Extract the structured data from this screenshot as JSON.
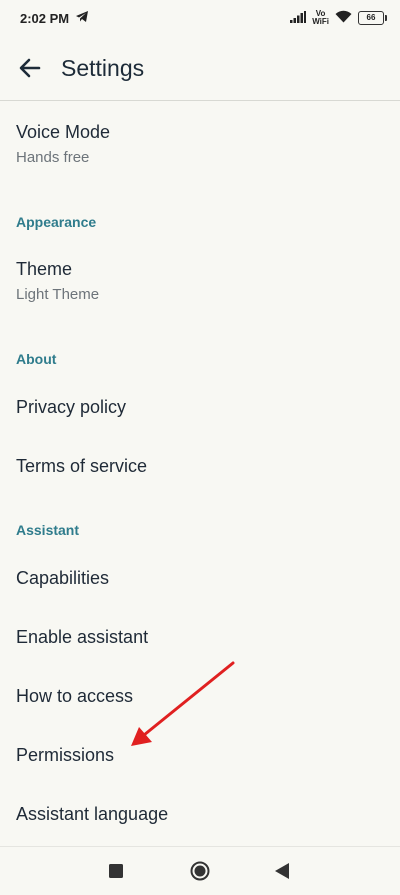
{
  "status_bar": {
    "time": "2:02 PM",
    "vowifi_top": "Vo",
    "vowifi_bottom": "WiFi",
    "battery": "66"
  },
  "header": {
    "title": "Settings"
  },
  "settings": {
    "voice_mode": {
      "title": "Voice Mode",
      "value": "Hands free"
    },
    "appearance_header": "Appearance",
    "theme": {
      "title": "Theme",
      "value": "Light Theme"
    },
    "about_header": "About",
    "privacy_policy": "Privacy policy",
    "terms_of_service": "Terms of service",
    "assistant_header": "Assistant",
    "capabilities": "Capabilities",
    "enable_assistant": "Enable assistant",
    "how_to_access": "How to access",
    "permissions": "Permissions",
    "assistant_language": "Assistant language"
  },
  "colors": {
    "background": "#f8f8f3",
    "section_header": "#2f7c8c",
    "annotation_arrow": "#e02020"
  },
  "icons": {
    "back": "arrow-left-icon",
    "telegram": "telegram-icon",
    "signal": "signal-icon",
    "wifi": "wifi-icon",
    "battery": "battery-icon",
    "recents": "square-icon",
    "home": "circle-icon",
    "back_nav": "triangle-left-icon"
  }
}
